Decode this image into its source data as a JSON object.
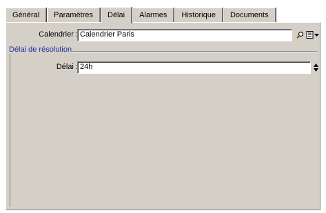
{
  "tabs": [
    {
      "label": "Général",
      "active": false
    },
    {
      "label": "Paramètres",
      "active": false
    },
    {
      "label": "Délai",
      "active": true
    },
    {
      "label": "Alarmes",
      "active": false
    },
    {
      "label": "Historique",
      "active": false
    },
    {
      "label": "Documents",
      "active": false
    }
  ],
  "calendar": {
    "label": "Calendrier :",
    "value": "Calendrier Paris",
    "icons": [
      "magnifier-icon",
      "details-icon",
      "dropdown-arrow-icon"
    ]
  },
  "resolution_group": {
    "caption": "Délai de résolution",
    "delay_label": "Délai :",
    "delay_value": "24h"
  },
  "colors": {
    "panel": "#d4d0c8",
    "group_caption": "#1a2a9c",
    "field_bg": "#ffffff"
  }
}
